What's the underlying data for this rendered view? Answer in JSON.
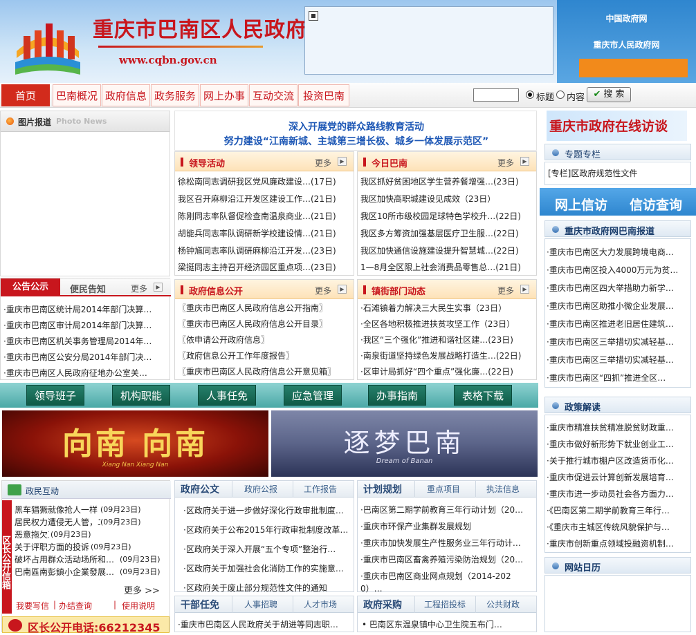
{
  "header": {
    "title": "重庆市巴南区人民政府",
    "url": "www.cqbn.gov.cn",
    "links": [
      "中国政府网",
      "重庆市人民政府网"
    ]
  },
  "nav": {
    "items": [
      "首页",
      "巴南概况",
      "政府信息",
      "政务服务",
      "网上办事",
      "互动交流",
      "投资巴南"
    ]
  },
  "search": {
    "radio_title": "标题",
    "radio_content": "内容",
    "button": "搜 索"
  },
  "photo_news": {
    "title": "图片报道",
    "subtitle": "Photo News"
  },
  "headline": {
    "line1": "深入开展党的群众路线教育活动",
    "line2": "努力建设“江南新城、主城第三增长极、城乡一体发展示范区”"
  },
  "more_label": "更多",
  "leadership": {
    "title": "领导活动",
    "items": [
      "徐松南同志调研我区党风廉政建设…(17日)",
      "我区召开麻柳沿江开发区建设工作…(21日)",
      "陈刚同志率队督促检查南温泉商业…(21日)",
      "胡能兵同志率队调研新学校建设情…(21日)",
      "杨钟馗同志率队调研麻柳沿江开发…(23日)",
      "梁挺同志主持召开经济园区重点项…(23日)"
    ]
  },
  "today": {
    "title": "今日巴南",
    "items": [
      "我区抓好贫困地区学生营养餐增强…(23日)",
      "我区加快高职城建设见成效（23日）",
      "我区10所市级校园足球特色学校升…(22日)",
      "我区多方筹资加强基层医疗卫生服…(22日)",
      "我区加快通信设施建设提升智慧城…(22日)",
      "1—8月全区限上社会消费品零售总…(21日)"
    ]
  },
  "notice": {
    "tabs": [
      "公告公示",
      "便民告知"
    ],
    "items": [
      "·重庆市巴南区统计局2014年部门决算…",
      "·重庆市巴南区审计局2014年部门决算…",
      "·重庆市巴南区机关事务管理局2014年…",
      "·重庆市巴南区公安分局2014年部门决…",
      "·重庆市巴南区人民政府征地办公室关…"
    ]
  },
  "gov_info": {
    "title": "政府信息公开",
    "items": [
      "〖重庆市巴南区人民政府信息公开指南〗",
      "〖重庆市巴南区人民政府信息公开目录〗",
      "〖依申请公开政府信息〗",
      "〖政府信息公开工作年度报告〗",
      "〖重庆市巴南区人民政府信息公开意见箱〗"
    ]
  },
  "towns": {
    "title": "镇街部门动态",
    "items": [
      "·石滩镇着力解决三大民生实事（23日）",
      "·全区各地积极推进扶贫攻坚工作（23日）",
      "·我区“三个强化”推进和谐社区建…(23日)",
      "·南泉街道坚持绿色发展战略打造生…(22日)",
      "·区审计局抓好“四个重点”强化廉…(22日)"
    ]
  },
  "quicklinks": [
    "领导班子",
    "机构职能",
    "人事任免",
    "应急管理",
    "办事指南",
    "表格下载"
  ],
  "banners": {
    "left_text": "向南 向南",
    "left_sub": "Xiang Nan Xiang Nan",
    "right_text": "逐梦巴南",
    "right_sub": "Dream of Banan"
  },
  "interaction": {
    "title": "政民互动",
    "side_label": "区长公开信箱",
    "items": [
      "黑车猖獗就像抢人一样",
      "居民权力遭侵无人管，二…",
      "恶意拖欠工资",
      "关于评职方面的投诉",
      "破坏占用群众活动场所和…",
      "巴南區南彭鎮小企業發展…"
    ],
    "dates": [
      "(09月23日)",
      "(09月23日)",
      "(09月23日)",
      "(09月23日)",
      "(09月23日)",
      "(09月23日)"
    ],
    "more": "更多 >>",
    "links": [
      "我要写信",
      "办结查询",
      "使用说明"
    ],
    "hotline": "区长公开电话:66212345"
  },
  "gov_docs": {
    "tabs": [
      "政府公文",
      "政府公报",
      "工作报告"
    ],
    "items": [
      "·区政府关于进一步做好深化行政审批制度…",
      "·区政府关于公布2015年行政审批制度改革…",
      "·区政府关于深入开展“五个专项”整治行…",
      "·区政府关于加强社会化消防工作的实施意…",
      "·区政府关于废止部分规范性文件的通知"
    ]
  },
  "planning": {
    "tabs": [
      "计划规划",
      "重点项目",
      "执法信息"
    ],
    "items": [
      "·巴南区第二期学前教育三年行动计划（20…",
      "·重庆市环保产业集群发展规划",
      "·重庆市加快发展生产性服务业三年行动计…",
      "·重庆市巴南区畜禽养殖污染防治规划（20…",
      "·重庆市巴南区商业网点规划（2014-202",
      "0）…"
    ]
  },
  "cadres": {
    "tabs": [
      "干部任免",
      "人事招聘",
      "人才市场"
    ],
    "items": [
      "·重庆市巴南区人民政府关于胡进等同志职…"
    ]
  },
  "procurement": {
    "tabs": [
      "政府采购",
      "工程招投标",
      "公共财政"
    ],
    "items": [
      "• 巴南区东温泉镇中心卫生院五布门…"
    ]
  },
  "right": {
    "interview": "重庆市政府在线访谈",
    "special": {
      "title": "专题专栏",
      "items": [
        "[专栏]区政府规范性文件"
      ]
    },
    "petition": [
      "网上信访",
      "信访查询"
    ],
    "cq_report": {
      "title": "重庆市政府网巴南报道",
      "items": [
        "·重庆市巴南区大力发展跨境电商…",
        "·重庆市巴南区投入4000万元为贫…",
        "·重庆市巴南区四大举措助力新学…",
        "·重庆市巴南区助推小微企业发展…",
        "·重庆市巴南区推进老旧居住建筑…",
        "·重庆市巴南区三举措切实减轻基…",
        "·重庆市巴南区三举措切实减轻基…",
        "·重庆市巴南区“四抓”推进全区…"
      ]
    },
    "policy": {
      "title": "政策解读",
      "items": [
        "·重庆市精准扶贫精准脱贫财政重…",
        "·重庆市做好新形势下就业创业工…",
        "·关于推行城市棚户区改造货币化…",
        "·重庆市促进云计算创新发展培育…",
        "·重庆市进一步动员社会各方面力…",
        "·《巴南区第二期学前教育三年行…",
        "·《重庆市主城区传统风貌保护与…",
        "·重庆市创新重点领域投融资机制…"
      ]
    },
    "calendar": {
      "title": "网站日历"
    }
  },
  "colors": {
    "red": "#c8161d",
    "navy": "#1a3d6b",
    "teal": "#0f5b47",
    "orange": "#f28a1b"
  }
}
